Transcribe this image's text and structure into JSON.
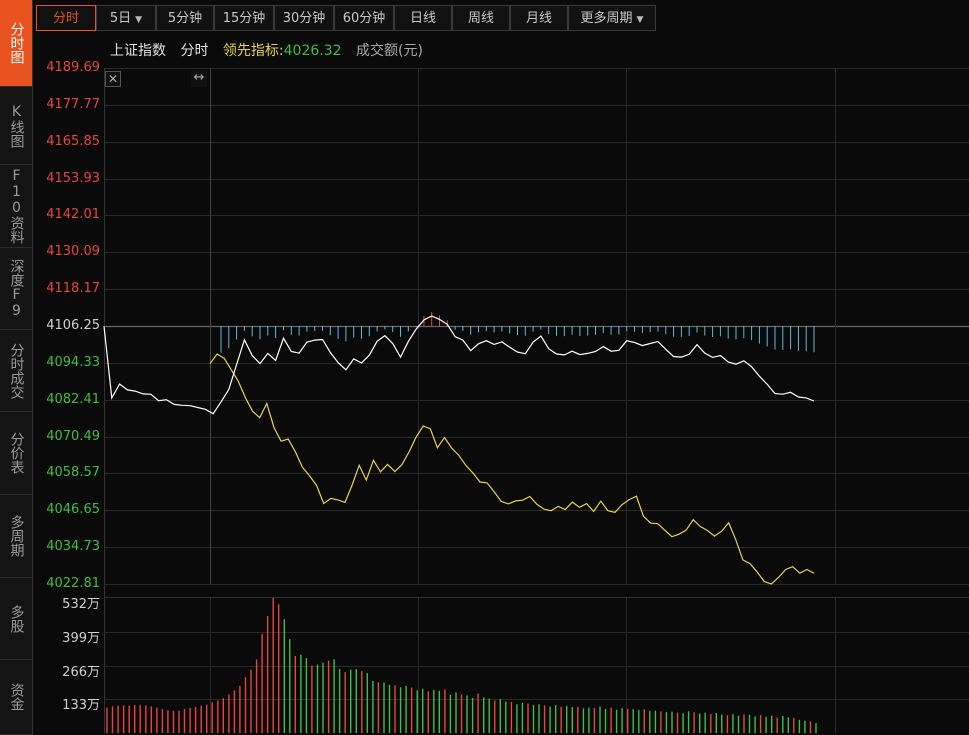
{
  "sidebar": {
    "tabs": [
      {
        "label": "分时图",
        "active": true
      },
      {
        "label": "K线图",
        "active": false
      },
      {
        "label": "F10资料",
        "active": false
      },
      {
        "label": "深度F9",
        "active": false
      },
      {
        "label": "分时成交",
        "active": false
      },
      {
        "label": "分价表",
        "active": false
      },
      {
        "label": "多周期",
        "active": false
      },
      {
        "label": "多股",
        "active": false
      },
      {
        "label": "资金",
        "active": false
      }
    ]
  },
  "toolbar": {
    "buttons": [
      {
        "label": "分时",
        "active": true,
        "dropdown": false
      },
      {
        "label": "5日",
        "active": false,
        "dropdown": true
      },
      {
        "label": "5分钟",
        "active": false,
        "dropdown": false
      },
      {
        "label": "15分钟",
        "active": false,
        "dropdown": false
      },
      {
        "label": "30分钟",
        "active": false,
        "dropdown": false
      },
      {
        "label": "60分钟",
        "active": false,
        "dropdown": false
      },
      {
        "label": "日线",
        "active": false,
        "dropdown": false
      },
      {
        "label": "周线",
        "active": false,
        "dropdown": false
      },
      {
        "label": "月线",
        "active": false,
        "dropdown": false
      },
      {
        "label": "更多周期",
        "active": false,
        "dropdown": true
      }
    ]
  },
  "info": {
    "index_name": "上证指数",
    "mode": "分时",
    "leading_label": "领先指标:",
    "leading_value": "4026.32",
    "volume_label": "成交额(元)"
  },
  "colors": {
    "up": "#e8453c",
    "down": "#3fbf3f",
    "accent": "#e8521e",
    "price_line": "#ffffff",
    "leading_line": "#e6d34a",
    "bar_up": "#e8453c",
    "bar_down": "#5bbcd6"
  },
  "icons": {
    "close": "close-icon",
    "resize": "resize-icon"
  },
  "chart_data": {
    "type": "line",
    "base_price": 4106.25,
    "y_ticks": [
      4189.69,
      4177.77,
      4165.85,
      4153.93,
      4142.01,
      4130.09,
      4118.17,
      4106.25,
      4094.33,
      4082.41,
      4070.49,
      4058.57,
      4046.65,
      4034.73,
      4022.81
    ],
    "ylim": [
      4022.81,
      4189.69
    ],
    "volume_ticks": [
      "532万",
      "399万",
      "266万",
      "133万"
    ],
    "volume_max": 532,
    "series": [
      {
        "values": [
          4106.2,
          4083.0,
          4087.5,
          4085.6,
          4085.2,
          4084.3,
          4084.2,
          4082.1,
          4082.4,
          4080.9,
          4080.6,
          4080.5,
          4079.9,
          4079.3,
          4077.9,
          4081.7,
          4085.7,
          4093.8,
          4101.8,
          4096.7,
          4094.1,
          4097.4,
          4095.1,
          4102.3,
          4098.0,
          4097.5,
          4101.0,
          4101.7,
          4101.9,
          4097.7,
          4094.4,
          4092.1,
          4095.6,
          4094.3,
          4096.8,
          4101.3,
          4103.1,
          4100.6,
          4096.2,
          4101.2,
          4105.2,
          4108.2,
          4109.5,
          4108.4,
          4106.8,
          4102.8,
          4101.7,
          4098.3,
          4100.5,
          4101.5,
          4100.3,
          4101.1,
          4099.4,
          4097.8,
          4097.3,
          4101.0,
          4103.0,
          4098.9,
          4097.2,
          4096.9,
          4098.1,
          4097.0,
          4097.4,
          4098.0,
          4099.6,
          4098.1,
          4098.4,
          4101.5,
          4100.9,
          4099.9,
          4100.6,
          4101.2,
          4098.7,
          4096.4,
          4096.2,
          4097.1,
          4100.2,
          4097.5,
          4096.1,
          4096.7,
          4094.6,
          4093.9,
          4095.0,
          4093.1,
          4090.0,
          4087.4,
          4084.4,
          4084.2,
          4084.8,
          4083.3,
          4083.0,
          4082.0
        ]
      },
      {
        "values": [
          4094.1,
          4097.2,
          4095.8,
          4092.1,
          4088.3,
          4083.0,
          4078.7,
          4076.6,
          4081.2,
          4073.4,
          4069.0,
          4069.7,
          4065.6,
          4060.6,
          4057.8,
          4054.7,
          4048.8,
          4050.5,
          4050.0,
          4049.2,
          4054.8,
          4061.2,
          4056.4,
          4062.8,
          4059.1,
          4061.5,
          4059.2,
          4061.4,
          4065.5,
          4070.3,
          4073.9,
          4073.0,
          4066.9,
          4070.2,
          4066.8,
          4064.5,
          4061.2,
          4058.7,
          4055.8,
          4055.5,
          4052.6,
          4049.5,
          4048.7,
          4049.7,
          4049.9,
          4051.1,
          4048.6,
          4047.0,
          4046.5,
          4047.9,
          4046.9,
          4049.3,
          4047.6,
          4048.8,
          4046.3,
          4049.6,
          4046.5,
          4046.0,
          4048.5,
          4050.1,
          4051.2,
          4044.7,
          4042.5,
          4042.3,
          4040.2,
          4038.1,
          4038.9,
          4040.2,
          4043.6,
          4041.4,
          4040.1,
          4038.3,
          4039.9,
          4042.6,
          4037.1,
          4030.6,
          4029.4,
          4026.7,
          4023.6,
          4022.8,
          4024.9,
          4027.5,
          4028.4,
          4026.3,
          4027.5,
          4026.3
        ]
      },
      {
        "name": "成交额",
        "values": [
          100,
          105,
          107,
          108,
          108,
          110,
          110,
          108,
          105,
          100,
          95,
          90,
          87,
          88,
          95,
          99,
          102,
          108,
          112,
          121,
          128,
          137,
          152,
          168,
          186,
          220,
          250,
          290,
          390,
          461,
          532,
          507,
          448,
          370,
          304,
          309,
          295,
          266,
          270,
          277,
          285,
          291,
          252,
          240,
          250,
          252,
          244,
          236,
          205,
          200,
          199,
          190,
          188,
          180,
          186,
          179,
          168,
          174,
          164,
          170,
          166,
          172,
          151,
          160,
          152,
          148,
          138,
          155,
          140,
          136,
          128,
          134,
          124,
          122,
          113,
          119,
          116,
          111,
          113,
          109,
          104,
          110,
          103,
          106,
          102,
          103,
          97,
          100,
          98,
          104,
          95,
          100,
          91,
          98,
          95,
          94,
          90,
          93,
          87,
          88,
          85,
          82,
          84,
          80,
          78,
          86,
          82,
          77,
          80,
          75,
          79,
          73,
          70,
          74,
          68,
          73,
          72,
          66,
          70,
          64,
          68,
          61,
          67,
          62,
          60,
          52,
          48,
          45,
          39
        ]
      }
    ]
  }
}
